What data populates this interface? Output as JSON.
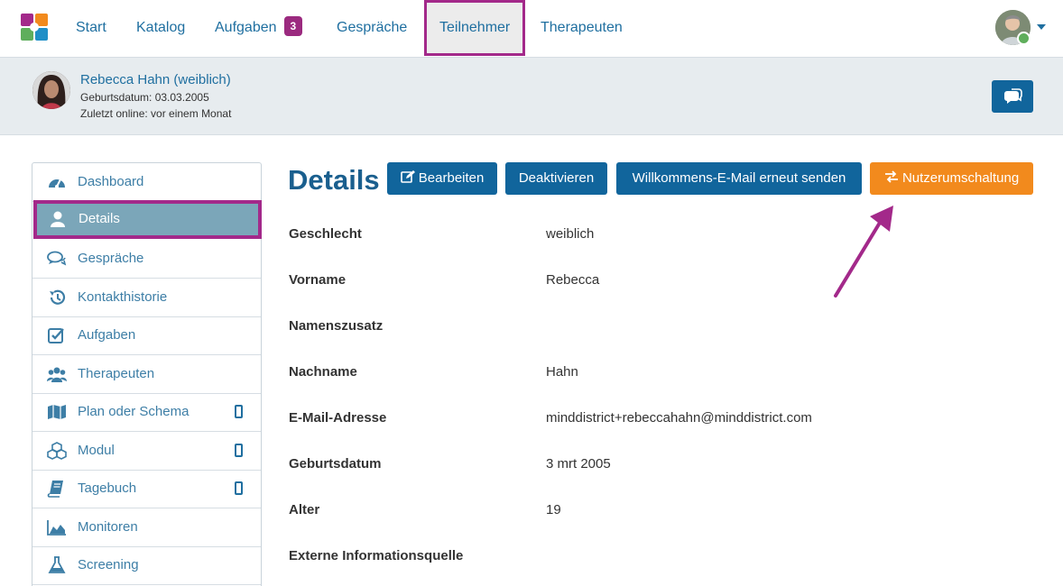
{
  "nav": {
    "items": [
      {
        "label": "Start"
      },
      {
        "label": "Katalog"
      },
      {
        "label": "Aufgaben",
        "badge": "3"
      },
      {
        "label": "Gespräche"
      },
      {
        "label": "Teilnehmer"
      },
      {
        "label": "Therapeuten"
      }
    ],
    "active": "Teilnehmer"
  },
  "participant": {
    "name": "Rebecca Hahn (weiblich)",
    "birthdate": "Geburtsdatum: 03.03.2005",
    "last_online": "Zuletzt online: vor einem Monat"
  },
  "sidebar": {
    "items": [
      {
        "label": "Dashboard",
        "icon": "dashboard-icon"
      },
      {
        "label": "Details",
        "icon": "user-icon"
      },
      {
        "label": "Gespräche",
        "icon": "chat-bubbles-icon"
      },
      {
        "label": "Kontakthistorie",
        "icon": "history-icon"
      },
      {
        "label": "Aufgaben",
        "icon": "checkbox-icon"
      },
      {
        "label": "Therapeuten",
        "icon": "users-icon"
      },
      {
        "label": "Plan oder Schema",
        "icon": "map-icon",
        "mobile": true
      },
      {
        "label": "Modul",
        "icon": "cubes-icon",
        "mobile": true
      },
      {
        "label": "Tagebuch",
        "icon": "book-icon",
        "mobile": true
      },
      {
        "label": "Monitoren",
        "icon": "area-chart-icon"
      },
      {
        "label": "Screening",
        "icon": "flask-icon"
      }
    ],
    "active": "Details"
  },
  "main": {
    "title": "Details",
    "buttons": {
      "edit": "Bearbeiten",
      "deactivate": "Deaktivieren",
      "resend": "Willkommens-E-Mail erneut senden",
      "switch_user": "Nutzerumschaltung"
    },
    "fields": [
      {
        "label": "Geschlecht",
        "value": "weiblich"
      },
      {
        "label": "Vorname",
        "value": "Rebecca"
      },
      {
        "label": "Namenszusatz",
        "value": ""
      },
      {
        "label": "Nachname",
        "value": "Hahn"
      },
      {
        "label": "E-Mail-Adresse",
        "value": "minddistrict+rebeccahahn@minddistrict.com"
      },
      {
        "label": "Geburtsdatum",
        "value": "3 mrt 2005"
      },
      {
        "label": "Alter",
        "value": "19"
      },
      {
        "label": "Externe Informationsquelle",
        "value": ""
      }
    ]
  },
  "colors": {
    "brand_blue": "#11659c",
    "link_blue": "#1f6fa0",
    "highlight_purple": "#a3298a",
    "orange": "#f28a1d",
    "active_sidebar": "#7ba6b9"
  }
}
